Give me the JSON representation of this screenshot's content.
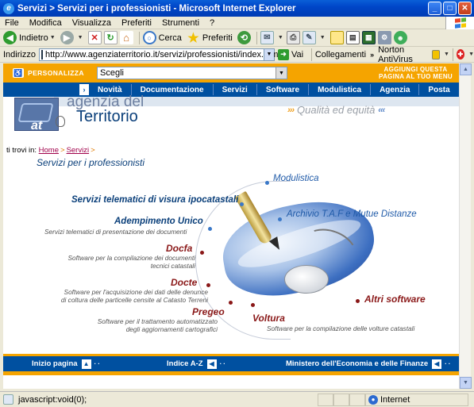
{
  "window": {
    "title": "Servizi > Servizi per i professionisti - Microsoft Internet Explorer",
    "menu": [
      "File",
      "Modifica",
      "Visualizza",
      "Preferiti",
      "Strumenti",
      "?"
    ]
  },
  "toolbar": {
    "back_label": "Indietro",
    "search_label": "Cerca",
    "favorites_label": "Preferiti"
  },
  "addressbar": {
    "label": "Indirizzo",
    "url": "http://www.agenziaterritorio.it/servizi/professionisti/index.htm",
    "go_label": "Vai",
    "links_label": "Collegamenti",
    "antivirus_label": "Norton AntiVirus"
  },
  "site": {
    "personalizza": "PERSONALIZZA",
    "select_value": "Scegli",
    "aggiungi_line1": "AGGIUNGI QUESTA",
    "aggiungi_line2": "PAGINA AL TUO MENU",
    "nav": [
      "Novità",
      "Documentazione",
      "Servizi",
      "Software",
      "Modulistica",
      "Agenzia",
      "Posta"
    ],
    "brand_line1": "agenzia del",
    "brand_line2": "Territorio",
    "tagline": "Qualità ed equità"
  },
  "breadcrumb": {
    "prefix": "ti trovi in:",
    "home": "Home",
    "servizi": "Servizi"
  },
  "page_title": "Servizi per i professionisti",
  "diagram": {
    "modulistica": "Modulistica",
    "telematici": "Servizi telematici di visura ipocatastali",
    "archivio": "Archivio T.A.F e Mutue Distanze",
    "adempimento": "Adempimento Unico",
    "adempimento_desc": "Servizi telematici di presentazione dei documenti",
    "docfa": "Docfa",
    "docfa_desc1": "Software per la compilazione dei documenti",
    "docfa_desc2": "tecnici catastali",
    "docte": "Docte",
    "docte_desc1": "Software per l'acquisizione dei dati delle denunce",
    "docte_desc2": "di coltura delle particelle censite al Catasto Terreni",
    "altri": "Altri software",
    "pregeo": "Pregeo",
    "pregeo_desc1": "Software per il trattamento automatizzato",
    "pregeo_desc2": "degli aggiornamenti cartografici",
    "voltura": "Voltura",
    "voltura_desc": "Software per la compilazione delle volture catastali"
  },
  "footer": {
    "inizio": "Inizio pagina",
    "indice": "Indice A-Z",
    "ministero": "Ministero dell'Economia e delle Finanze"
  },
  "status": {
    "text": "javascript:void(0);",
    "zone": "Internet"
  }
}
